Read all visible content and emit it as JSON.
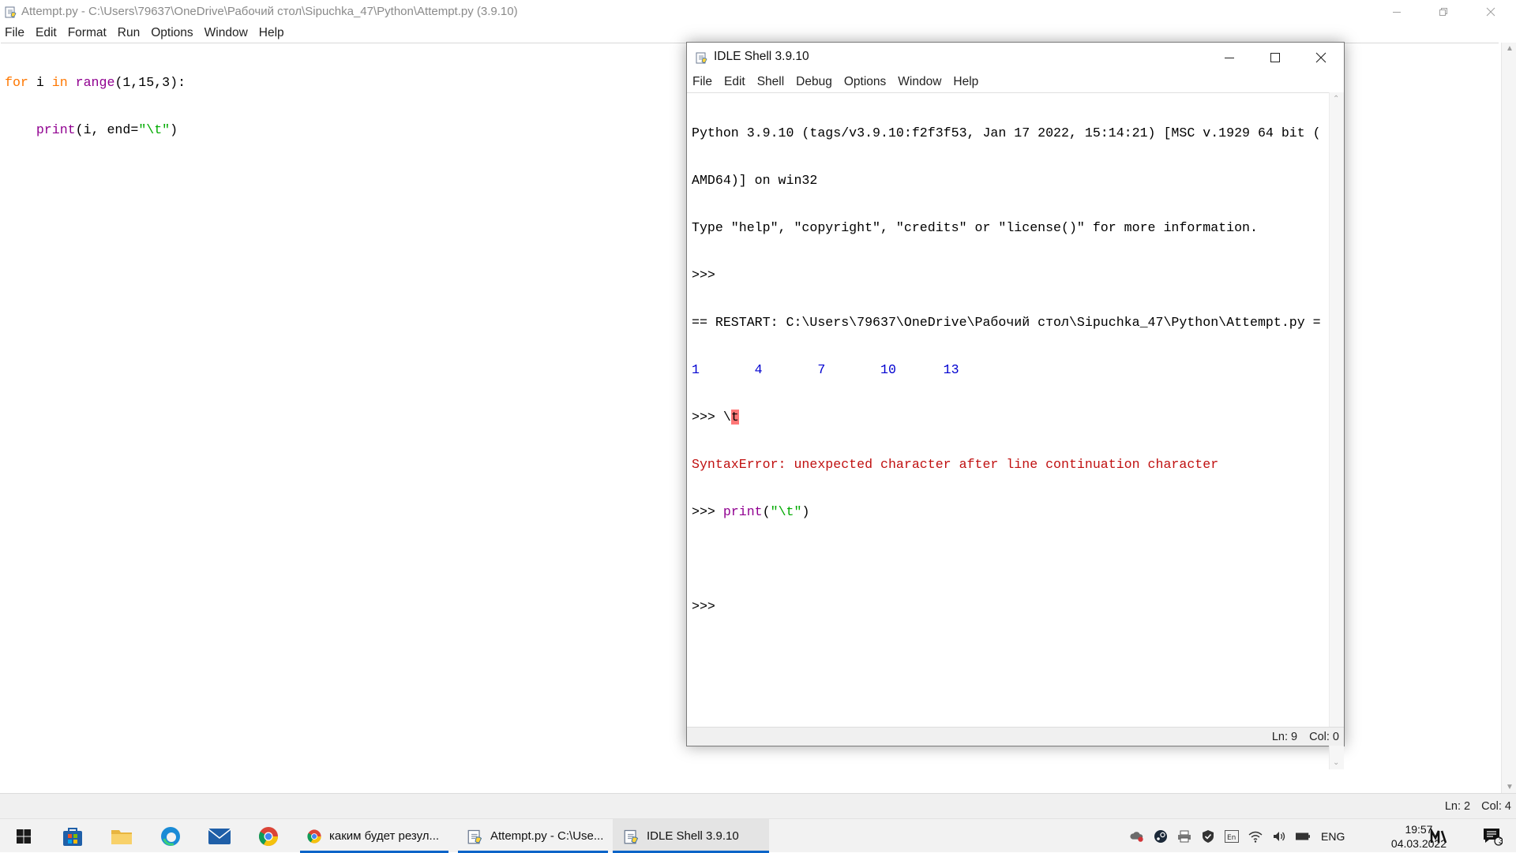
{
  "editor": {
    "title": "Attempt.py - C:\\Users\\79637\\OneDrive\\Рабочий стол\\Sipuchka_47\\Python\\Attempt.py (3.9.10)",
    "menu": [
      "File",
      "Edit",
      "Format",
      "Run",
      "Options",
      "Window",
      "Help"
    ],
    "code": {
      "line1": {
        "kw1": "for",
        "var": " i ",
        "kw2": "in",
        "sp": " ",
        "builtin": "range",
        "rest": "(1,15,3):"
      },
      "line2": {
        "indent": "    ",
        "builtin": "print",
        "mid": "(i, end=",
        "string": "\"\\t\"",
        "close": ")"
      }
    },
    "status": {
      "line": "Ln: 2",
      "col": "Col: 4"
    }
  },
  "shell": {
    "title": "IDLE Shell 3.9.10",
    "menu": [
      "File",
      "Edit",
      "Shell",
      "Debug",
      "Options",
      "Window",
      "Help"
    ],
    "lines": {
      "banner1": "Python 3.9.10 (tags/v3.9.10:f2f3f53, Jan 17 2022, 15:14:21) [MSC v.1929 64 bit (",
      "banner2": "AMD64)] on win32",
      "banner3": "Type \"help\", \"copyright\", \"credits\" or \"license()\" for more information.",
      "prompt": ">>> ",
      "restart": "== RESTART: C:\\Users\\79637\\OneDrive\\Рабочий стол\\Sipuchka_47\\Python\\Attempt.py =",
      "output": "1\t4\t7\t10\t13",
      "cmd1_pre": "\\",
      "cmd1_hl": "t",
      "error": "SyntaxError: unexpected character after line continuation character",
      "cmd2_builtin": "print",
      "cmd2_open": "(",
      "cmd2_string": "\"\\t\"",
      "cmd2_close": ")"
    },
    "status": {
      "line": "Ln: 9",
      "col": "Col: 0"
    }
  },
  "taskbar": {
    "apps": [
      {
        "label": "каким будет резул...",
        "icon": "chrome-icon"
      },
      {
        "label": "Attempt.py - C:\\Use...",
        "icon": "python-idle-icon"
      },
      {
        "label": "IDLE Shell 3.9.10",
        "icon": "python-idle-icon"
      }
    ],
    "lang": "ENG",
    "time": "19:57",
    "date": "04.03.2022",
    "notifications": "3"
  },
  "colors": {
    "keyword": "#ff7700",
    "builtin": "#900090",
    "string": "#00aa00",
    "stdout": "#0000d0",
    "error": "#c01010",
    "accent": "#0a64c8"
  }
}
